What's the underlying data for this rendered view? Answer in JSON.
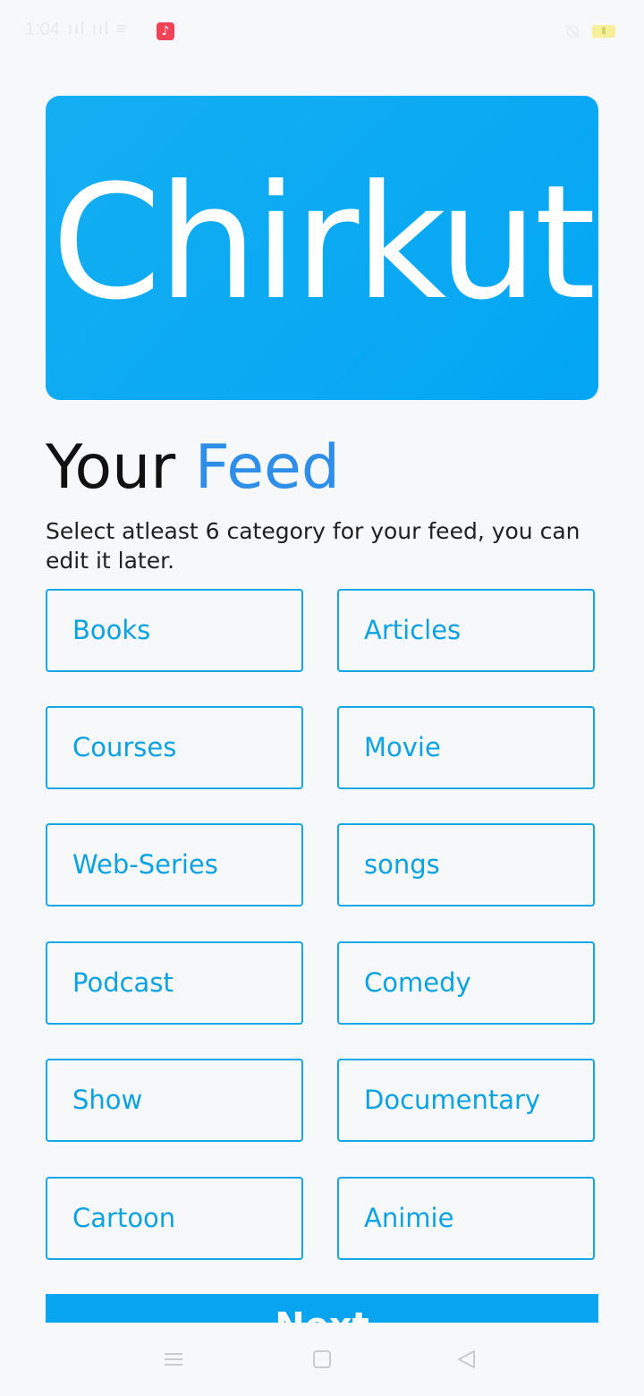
{
  "status": {
    "time": "1:04",
    "signal": "ııl ııl ≡"
  },
  "banner": {
    "logo_text": "Chirkut"
  },
  "title": {
    "prefix": "Your",
    "accent": "Feed"
  },
  "subtitle": "Select atleast 6 category for your feed, you can edit it later.",
  "categories": [
    "Books",
    "Articles",
    "Courses",
    "Movie",
    "Web-Series",
    "songs",
    "Podcast",
    "Comedy",
    "Show",
    "Documentary",
    "Cartoon",
    "Animie"
  ],
  "next_label": "Next",
  "colors": {
    "brand_blue": "#03a6f4",
    "accent_blue": "#2f8fe8",
    "border_blue": "#15a6e4"
  },
  "icons": {
    "music": "music-note-icon",
    "silent": "silent-icon",
    "battery": "battery-icon",
    "nav_menu": "menu-icon",
    "nav_home": "home-square-icon",
    "nav_back": "back-triangle-icon"
  }
}
